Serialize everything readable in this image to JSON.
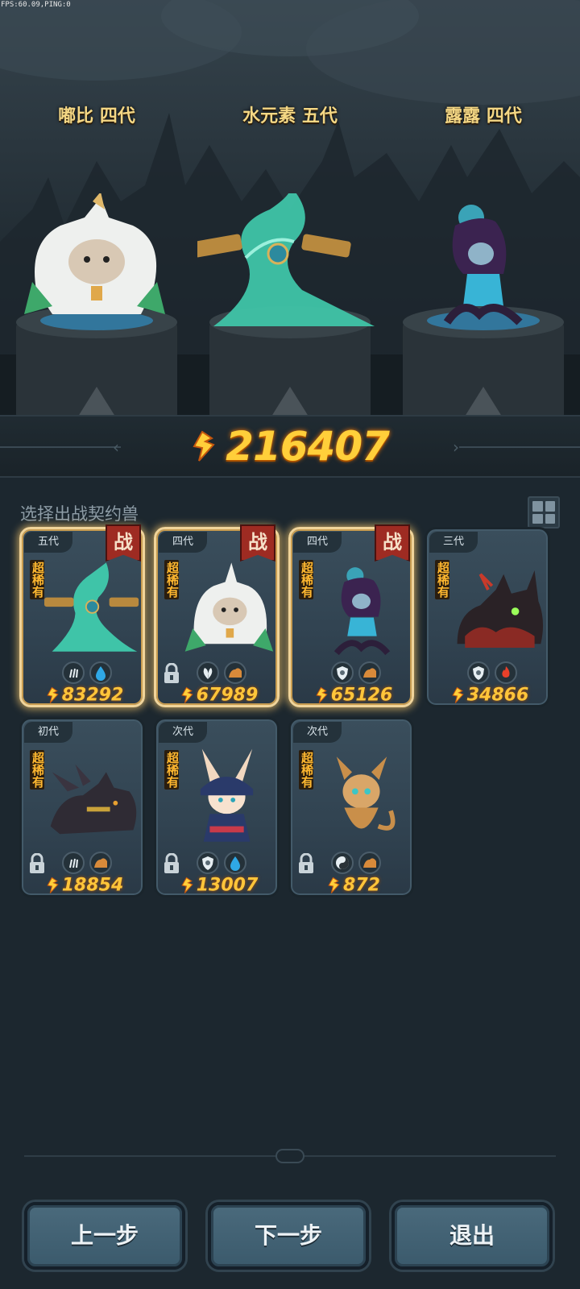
{
  "debug": {
    "fps_text": "FPS:60.09,PING:0"
  },
  "team": [
    {
      "name": "嘟比 四代"
    },
    {
      "name": "水元素 五代"
    },
    {
      "name": "露露 四代"
    }
  ],
  "total_power": "216407",
  "section": {
    "title": "选择出战契约兽",
    "grid_icon": "grid-view-icon"
  },
  "cards": [
    {
      "generation": "五代",
      "rarity": "超稀有",
      "battle": "战",
      "power": "83292",
      "selected": true,
      "locked": false,
      "creature": "water-elemental",
      "traits": [
        "claw-icon",
        "water-drop-icon"
      ]
    },
    {
      "generation": "四代",
      "rarity": "超稀有",
      "battle": "战",
      "power": "67989",
      "selected": true,
      "locked": true,
      "creature": "dubi",
      "traits": [
        "leaf-icon",
        "earth-icon"
      ]
    },
    {
      "generation": "四代",
      "rarity": "超稀有",
      "battle": "战",
      "power": "65126",
      "selected": true,
      "locked": false,
      "creature": "lulu",
      "traits": [
        "shield-icon",
        "earth-icon"
      ]
    },
    {
      "generation": "三代",
      "rarity": "超稀有",
      "battle": "",
      "power": "34866",
      "selected": false,
      "locked": false,
      "creature": "dark-beast",
      "traits": [
        "shield-icon",
        "fire-icon"
      ]
    },
    {
      "generation": "初代",
      "rarity": "超稀有",
      "battle": "",
      "power": "18854",
      "selected": false,
      "locked": true,
      "creature": "shadow-wolf",
      "traits": [
        "claw-icon",
        "earth-icon"
      ]
    },
    {
      "generation": "次代",
      "rarity": "超稀有",
      "battle": "",
      "power": "13007",
      "selected": false,
      "locked": true,
      "creature": "bunny-witch",
      "traits": [
        "shield-icon",
        "water-drop-icon"
      ]
    },
    {
      "generation": "次代",
      "rarity": "超稀有",
      "battle": "",
      "power": "872",
      "selected": false,
      "locked": true,
      "creature": "bronze-dragon",
      "traits": [
        "yinyang-icon",
        "earth-icon"
      ]
    }
  ],
  "nav": {
    "prev": "上一步",
    "next": "下一步",
    "exit": "退出"
  },
  "colors": {
    "gold": "#ffc53a",
    "badge_red": "#9e2b22",
    "card_bg": "#334655"
  }
}
